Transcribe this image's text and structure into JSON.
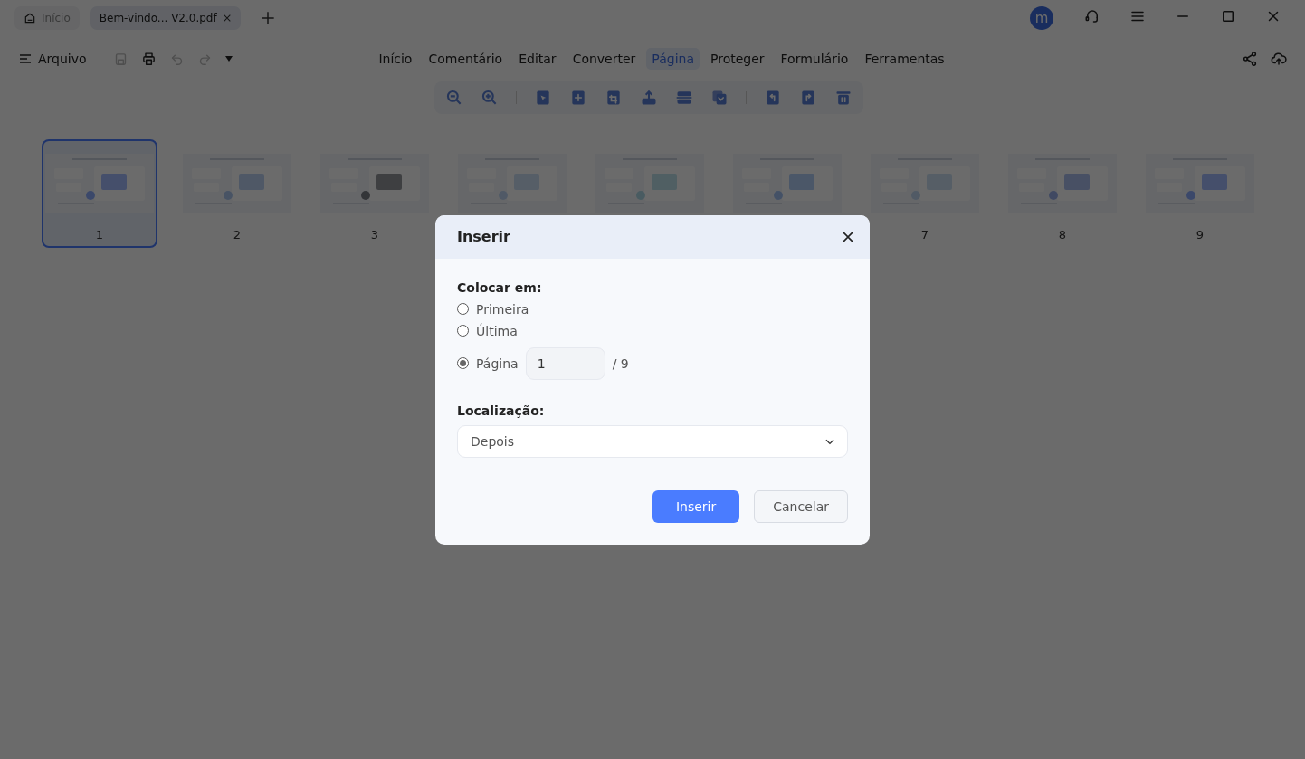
{
  "tabs": [
    {
      "label": "Início",
      "selected": false,
      "kind": "home"
    },
    {
      "label": "Bem-vindo... V2.0.pdf",
      "selected": true,
      "kind": "document"
    }
  ],
  "avatar": {
    "initial": "m"
  },
  "file_menu": {
    "label": "Arquivo"
  },
  "quick_tools": [
    {
      "kind": "save",
      "disabled": true
    },
    {
      "kind": "print",
      "disabled": false
    },
    {
      "kind": "undo",
      "disabled": true
    },
    {
      "kind": "redo",
      "disabled": true
    }
  ],
  "menu": [
    {
      "label": "Início",
      "selected": false
    },
    {
      "label": "Comentário",
      "selected": false
    },
    {
      "label": "Editar",
      "selected": false
    },
    {
      "label": "Converter",
      "selected": false
    },
    {
      "label": "Página",
      "selected": true
    },
    {
      "label": "Proteger",
      "selected": false
    },
    {
      "label": "Formulário",
      "selected": false
    },
    {
      "label": "Ferramentas",
      "selected": false
    }
  ],
  "pages": [
    {
      "number": "1",
      "selected": true
    },
    {
      "number": "2",
      "selected": false
    },
    {
      "number": "3",
      "selected": false
    },
    {
      "selected": false
    },
    {
      "selected": false
    },
    {
      "selected": false
    },
    {
      "number": "7",
      "selected": false
    },
    {
      "number": "8",
      "selected": false
    },
    {
      "number": "9",
      "selected": false
    }
  ],
  "dialog": {
    "title": "Inserir",
    "place_label": "Colocar em:",
    "options": [
      {
        "label": "Primeira",
        "selected": false,
        "kind": "plain"
      },
      {
        "label": "Última",
        "selected": false,
        "kind": "plain"
      },
      {
        "label": "Página",
        "selected": true,
        "kind": "page",
        "value": "1",
        "total": "/ 9"
      }
    ],
    "location_label": "Localização:",
    "location_value": "Depois",
    "buttons": [
      {
        "label": "Inserir",
        "kind": "primary"
      },
      {
        "label": "Cancelar",
        "kind": "secondary"
      }
    ]
  }
}
